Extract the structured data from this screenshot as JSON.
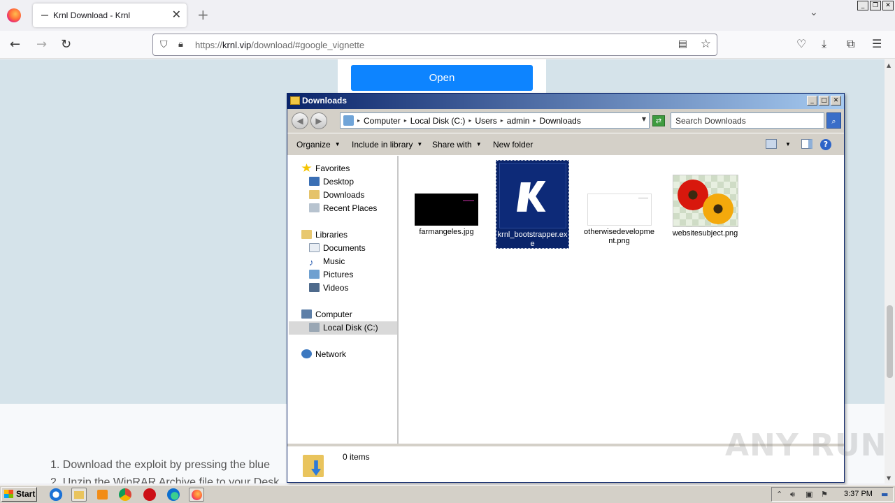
{
  "browser": {
    "tab_title": "Krnl Download - Krnl",
    "url_prefix": "https://",
    "url_host": "krnl.vip",
    "url_path": "/download/#google_vignette"
  },
  "page": {
    "open_button": "Open",
    "instruction_1": "1. Download the exploit by pressing the blue",
    "instruction_2": "2. Unzip the WinRAR Archive file to your Desk"
  },
  "explorer": {
    "title": "Downloads",
    "breadcrumbs": [
      "Computer",
      "Local Disk (C:)",
      "Users",
      "admin",
      "Downloads"
    ],
    "search_placeholder": "Search Downloads",
    "commands": {
      "organize": "Organize",
      "include_in_library": "Include in library",
      "share_with": "Share with",
      "new_folder": "New folder"
    },
    "nav": {
      "favorites": "Favorites",
      "desktop": "Desktop",
      "downloads": "Downloads",
      "recent_places": "Recent Places",
      "libraries": "Libraries",
      "documents": "Documents",
      "music": "Music",
      "pictures": "Pictures",
      "videos": "Videos",
      "computer": "Computer",
      "local_disk": "Local Disk (C:)",
      "network": "Network"
    },
    "files": [
      {
        "name": "farmangeles.jpg"
      },
      {
        "name": "krnl_bootstrapper.exe",
        "selected": true
      },
      {
        "name": "otherwisedevelopment.png"
      },
      {
        "name": "websitesubject.png"
      }
    ],
    "status_count": "0 items"
  },
  "watermark": "ANY RUN",
  "taskbar": {
    "start_label": "Start",
    "clock": "3:37 PM"
  },
  "colors": {
    "accent_button": "#0d84ff",
    "page_bg": "#d5e3ea",
    "titlebar_start": "#0a246a",
    "titlebar_end": "#a6caf0",
    "selection": "#0a246a"
  }
}
